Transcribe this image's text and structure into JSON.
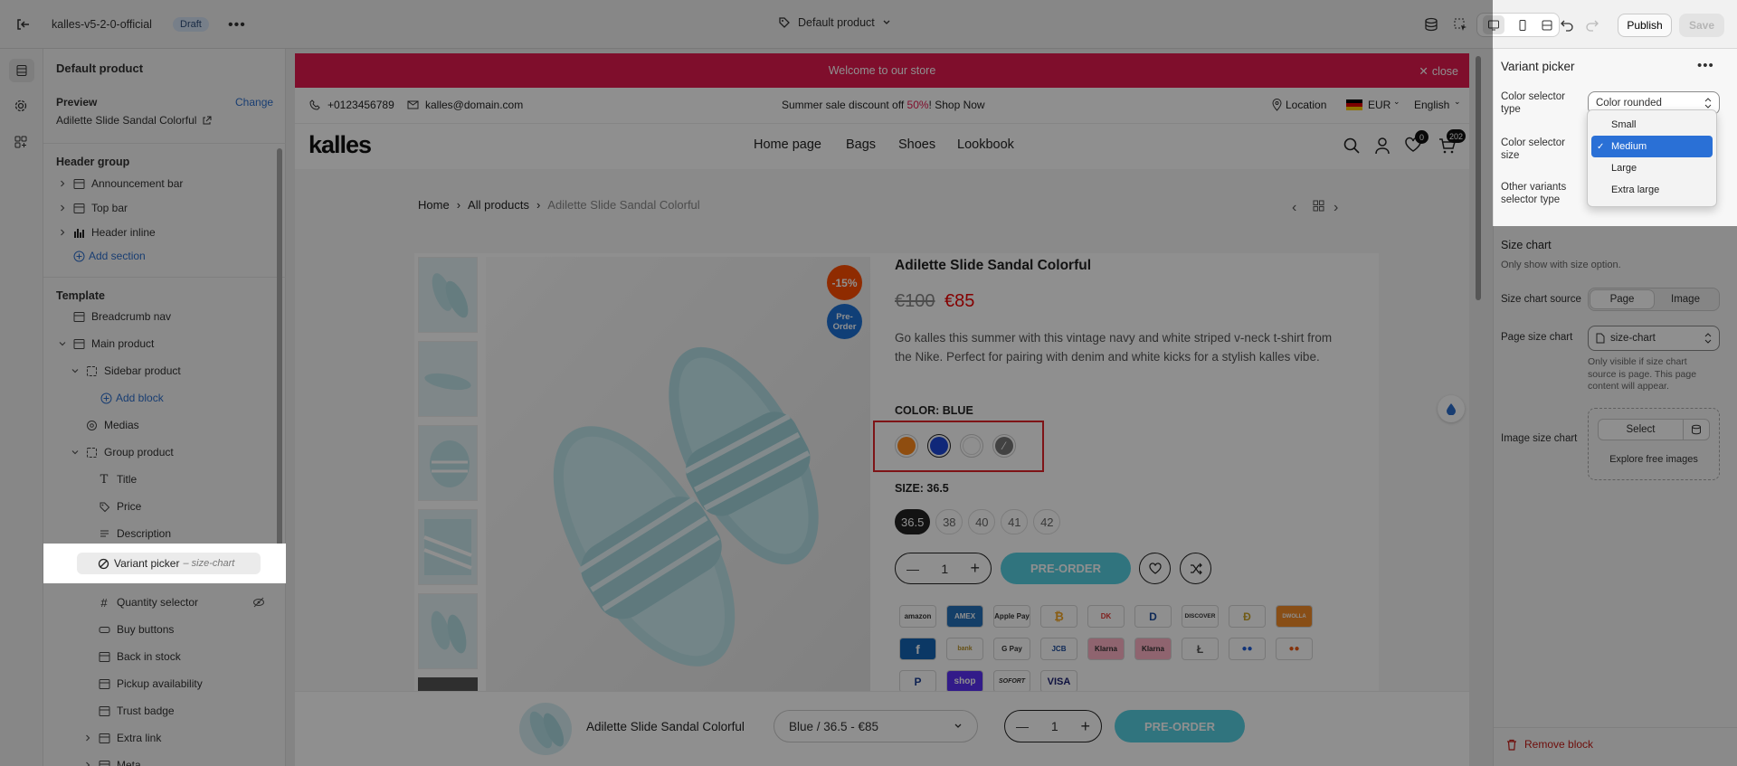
{
  "topbar": {
    "store_name": "kalles-v5-2-0-official",
    "status_badge": "Draft",
    "template_name": "Default product",
    "publish_label": "Publish",
    "save_label": "Save"
  },
  "left_panel": {
    "title": "Default product",
    "preview_label": "Preview",
    "change_label": "Change",
    "preview_product": "Adilette Slide Sandal Colorful",
    "header_group_label": "Header group",
    "header_items": [
      "Announcement bar",
      "Top bar",
      "Header inline"
    ],
    "add_section_label": "Add section",
    "template_label": "Template",
    "template_items": {
      "breadcrumb": "Breadcrumb nav",
      "main_product": "Main product",
      "sidebar_product": "Sidebar product",
      "add_block": "Add block",
      "medias": "Medias",
      "group_product": "Group product",
      "title": "Title",
      "price": "Price",
      "description": "Description",
      "variant_picker": "Variant picker",
      "variant_picker_suffix": "– size-chart",
      "quantity_selector": "Quantity selector",
      "buy_buttons": "Buy buttons",
      "back_in_stock": "Back in stock",
      "pickup_availability": "Pickup availability",
      "trust_badge": "Trust badge",
      "extra_link": "Extra link",
      "meta": "Meta"
    }
  },
  "store": {
    "announcement": "Welcome to our store",
    "close_label": "close",
    "phone": "+0123456789",
    "email": "kalles@domain.com",
    "promo_prefix": "Summer sale discount off ",
    "promo_percent": "50%",
    "promo_suffix": "! Shop Now",
    "location_label": "Location",
    "currency": "EUR",
    "language": "English",
    "logo": "kalles",
    "nav": [
      "Home page",
      "Bags",
      "Shoes",
      "Lookbook"
    ],
    "wishlist_count": "0",
    "cart_count": "202",
    "breadcrumb": [
      "Home",
      "All products",
      "Adilette Slide Sandal Colorful"
    ],
    "sale_badge": "-15%",
    "preorder_badge_line1": "Pre-",
    "preorder_badge_line2": "Order",
    "product_title": "Adilette Slide Sandal Colorful",
    "price_old": "€100",
    "price_new": "€85",
    "description": "Go kalles this summer with this vintage navy and white striped v-neck t-shirt from the Nike. Perfect for pairing with denim and white kicks for a stylish kalles vibe.",
    "color_label": "COLOR: BLUE",
    "size_label": "SIZE: 36.5",
    "sizes": [
      "36.5",
      "38",
      "40",
      "41",
      "42"
    ],
    "quantity": "1",
    "preorder_button": "PRE-ORDER",
    "payments": [
      "amazon",
      "AMEX",
      "Apple Pay",
      "₿",
      "DK",
      "D",
      "DISCOVER",
      "Ð",
      "DWOLLA",
      "f",
      "bank",
      "G Pay",
      "JCB",
      "Klarna",
      "Klarna",
      "Ł",
      "●●",
      "●●",
      "P",
      "shop",
      "SOFORT",
      "VISA"
    ],
    "sticky_title": "Adilette Slide Sandal Colorful",
    "sticky_variant": "Blue / 36.5 - €85",
    "sticky_quantity": "1",
    "sticky_button": "PRE-ORDER"
  },
  "right_panel": {
    "title": "Variant picker",
    "color_selector_type_label": "Color selector type",
    "color_selector_type_value": "Color rounded",
    "color_selector_size_label": "Color selector size",
    "dropdown_options": [
      "Small",
      "Medium",
      "Large",
      "Extra large"
    ],
    "dropdown_selected": "Medium",
    "other_variants_label": "Other variants selector type",
    "size_chart_heading": "Size chart",
    "size_chart_help": "Only show with size option.",
    "size_chart_source_label": "Size chart source",
    "source_options": [
      "Page",
      "Image"
    ],
    "page_size_chart_label": "Page size chart",
    "page_size_chart_value": "size-chart",
    "page_size_chart_help": "Only visible if size chart source is page. This page content will appear.",
    "image_size_chart_label": "Image size chart",
    "select_label": "Select",
    "explore_label": "Explore free images",
    "remove_block_label": "Remove block"
  },
  "colors": {
    "announcement_bg": "#e2194f",
    "accent_blue": "#2c6ecb",
    "sale_badge": "#ff4e00",
    "preorder_badge": "#1d71d4",
    "preorder_button": "#56cfe1",
    "remove_red": "#c41b16",
    "highlight_red": "#e0242a"
  }
}
